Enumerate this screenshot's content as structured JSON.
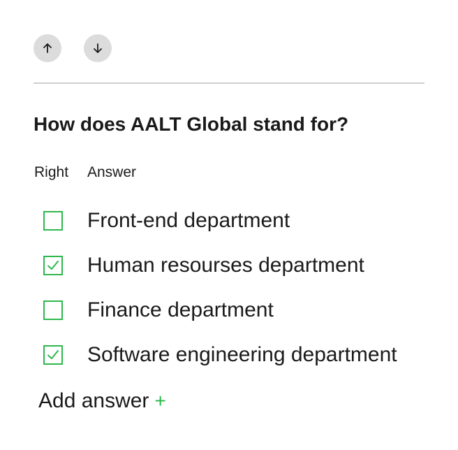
{
  "navigation": {
    "move_up_icon": "arrow-up-icon",
    "move_down_icon": "arrow-down-icon"
  },
  "question": {
    "title": "How does AALT Global stand for?"
  },
  "columns": {
    "right": "Right",
    "answer": "Answer"
  },
  "answers": [
    {
      "label": "Front-end department",
      "correct": false
    },
    {
      "label": "Human resourses department",
      "correct": true
    },
    {
      "label": "Finance department",
      "correct": false
    },
    {
      "label": "Software engineering department",
      "correct": true
    }
  ],
  "add_answer": {
    "label": "Add answer",
    "icon": "+"
  },
  "colors": {
    "accent": "#2db84d",
    "nav_button_bg": "#dcdcdc",
    "divider": "#cfcfcf",
    "text": "#1a1a1a"
  }
}
